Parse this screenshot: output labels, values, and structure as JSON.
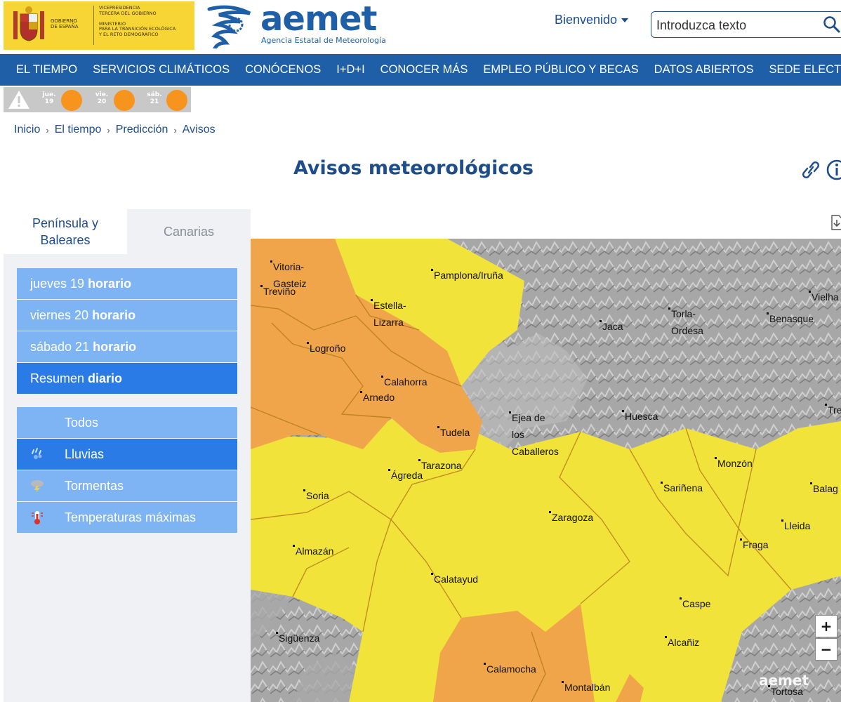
{
  "header": {
    "gov_left": "GOBIERNO\nDE ESPAÑA",
    "gov_right": "VICEPRESIDENCIA\nTERCERA DEL GOBIERNO\n\nMINISTERIO\nPARA LA TRANSICIÓN ECOLÓGICA\nY EL RETO DEMOGRÁFICO",
    "brand": "aemet",
    "brand_sub": "Agencia Estatal de Meteorología",
    "welcome": "Bienvenido",
    "search_placeholder": "Introduzca texto"
  },
  "nav": [
    "EL TIEMPO",
    "SERVICIOS CLIMÁTICOS",
    "CONÓCENOS",
    "I+D+I",
    "CONOCER MÁS",
    "EMPLEO PÚBLICO Y BECAS",
    "DATOS ABIERTOS",
    "SEDE ELECTRÓNICA"
  ],
  "warning_days": [
    {
      "label": "jue.\n19",
      "level": "orange"
    },
    {
      "label": "vie.\n20",
      "level": "orange"
    },
    {
      "label": "sáb.\n21",
      "level": "orange"
    }
  ],
  "breadcrumb": [
    "Inicio",
    "El tiempo",
    "Predicción",
    "Avisos"
  ],
  "page_title": "Avisos meteorológicos",
  "tabs": {
    "active": "Península y\nBaleares",
    "inactive": "Canarias"
  },
  "days": [
    {
      "day": "jueves 19",
      "mode": "horario"
    },
    {
      "day": "viernes 20",
      "mode": "horario"
    },
    {
      "day": "sábado 21",
      "mode": "horario"
    },
    {
      "day": "Resumen",
      "mode": "diario"
    }
  ],
  "filters": [
    "Todos",
    "Lluvias",
    "Tormentas",
    "Temperaturas máximas"
  ],
  "map": {
    "zoom_in": "+",
    "zoom_out": "−",
    "watermark": "aemet",
    "cities": [
      "Vitoria-\nGasteiz",
      "Treviño",
      "Pamplona/Iruña",
      "Estella-\nLizarra",
      "Logroño",
      "Calahorra",
      "Arnedo",
      "Tudela",
      "Tarazona",
      "Ágreda",
      "Soria",
      "Almazán",
      "Calatayud",
      "Sigüenza",
      "Calamocha",
      "Montalbán",
      "Zaragoza",
      "Ejea de\nlos\nCaballeros",
      "Jaca",
      "Torla-\nOrdesa",
      "Huesca",
      "Benasque",
      "Vielha",
      "Monzón",
      "Sariñena",
      "Lleida",
      "Fraga",
      "Caspe",
      "Alcañiz",
      "Balag",
      "Tortosa",
      "Tre"
    ]
  },
  "colors": {
    "brand_blue": "#1e5fa8",
    "warning_orange": "#f7941d",
    "warning_yellow": "#f2e33a",
    "item_blue": "#7eb4f3",
    "item_selected": "#2b7be6"
  }
}
